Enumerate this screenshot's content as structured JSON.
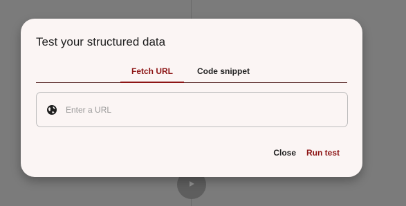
{
  "dialog": {
    "title": "Test your structured data",
    "tabs": [
      {
        "label": "Fetch URL",
        "active": true
      },
      {
        "label": "Code snippet",
        "active": false
      }
    ],
    "url_input": {
      "placeholder": "Enter a URL",
      "value": ""
    },
    "icons": {
      "url_field": "globe-icon",
      "background_button": "play-icon"
    },
    "actions": {
      "close_label": "Close",
      "run_label": "Run test"
    }
  },
  "colors": {
    "accent": "#8c1414",
    "overlay": "#7b7b7b",
    "dialog_bg": "#fbf5f4"
  }
}
